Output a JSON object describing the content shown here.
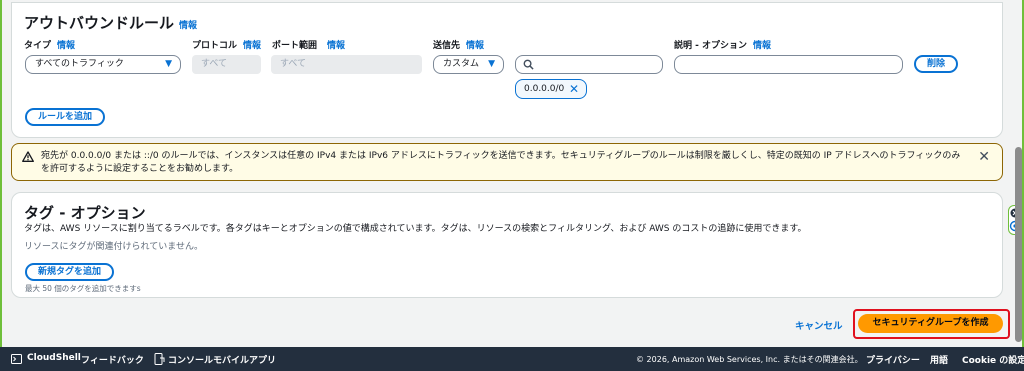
{
  "outbound": {
    "title": "アウトバウンドルール",
    "info": "情報",
    "columns": {
      "type": "タイプ",
      "protocol": "プロトコル",
      "port_range": "ポート範囲",
      "destination": "送信先",
      "description": "説明 - オプション"
    },
    "rule": {
      "type_value": "すべてのトラフィック",
      "protocol_value": "すべて",
      "port_value": "すべて",
      "destination_value": "カスタム",
      "cidr_token": "0.0.0.0/0",
      "delete_label": "削除"
    },
    "add_rule_label": "ルールを追加"
  },
  "warning": {
    "text": "宛先が 0.0.0.0/0 または ::/0 のルールでは、インスタンスは任意の IPv4 または IPv6 アドレスにトラフィックを送信できます。セキュリティグループのルールは制限を厳しくし、特定の既知の IP アドレスへのトラフィックのみを許可するように設定することをお勧めします。"
  },
  "tags": {
    "title": "タグ - オプション",
    "description": "タグは、AWS リソースに割り当てるラベルです。各タグはキーとオプションの値で構成されています。タグは、リソースの検索とフィルタリング、および AWS のコストの追跡に使用できます。",
    "empty": "リソースにタグが関連付けられていません。",
    "add_tag_label": "新規タグを追加",
    "limit": "最大 50 個のタグを追加できますs"
  },
  "actions": {
    "cancel": "キャンセル",
    "create": "セキュリティグループを作成"
  },
  "footer": {
    "cloudshell": "CloudShell",
    "feedback": "フィードバック",
    "console_mobile": "コンソールモバイルアプリ",
    "copyright": "© 2026, Amazon Web Services, Inc. またはその関連会社。",
    "privacy": "プライバシー",
    "terms": "用語",
    "cookie": "Cookie の設定"
  },
  "colors": {
    "accent": "#0972d3",
    "primary": "#ff9900",
    "highlight": "#e0101e",
    "footer_bg": "#232f3e"
  }
}
